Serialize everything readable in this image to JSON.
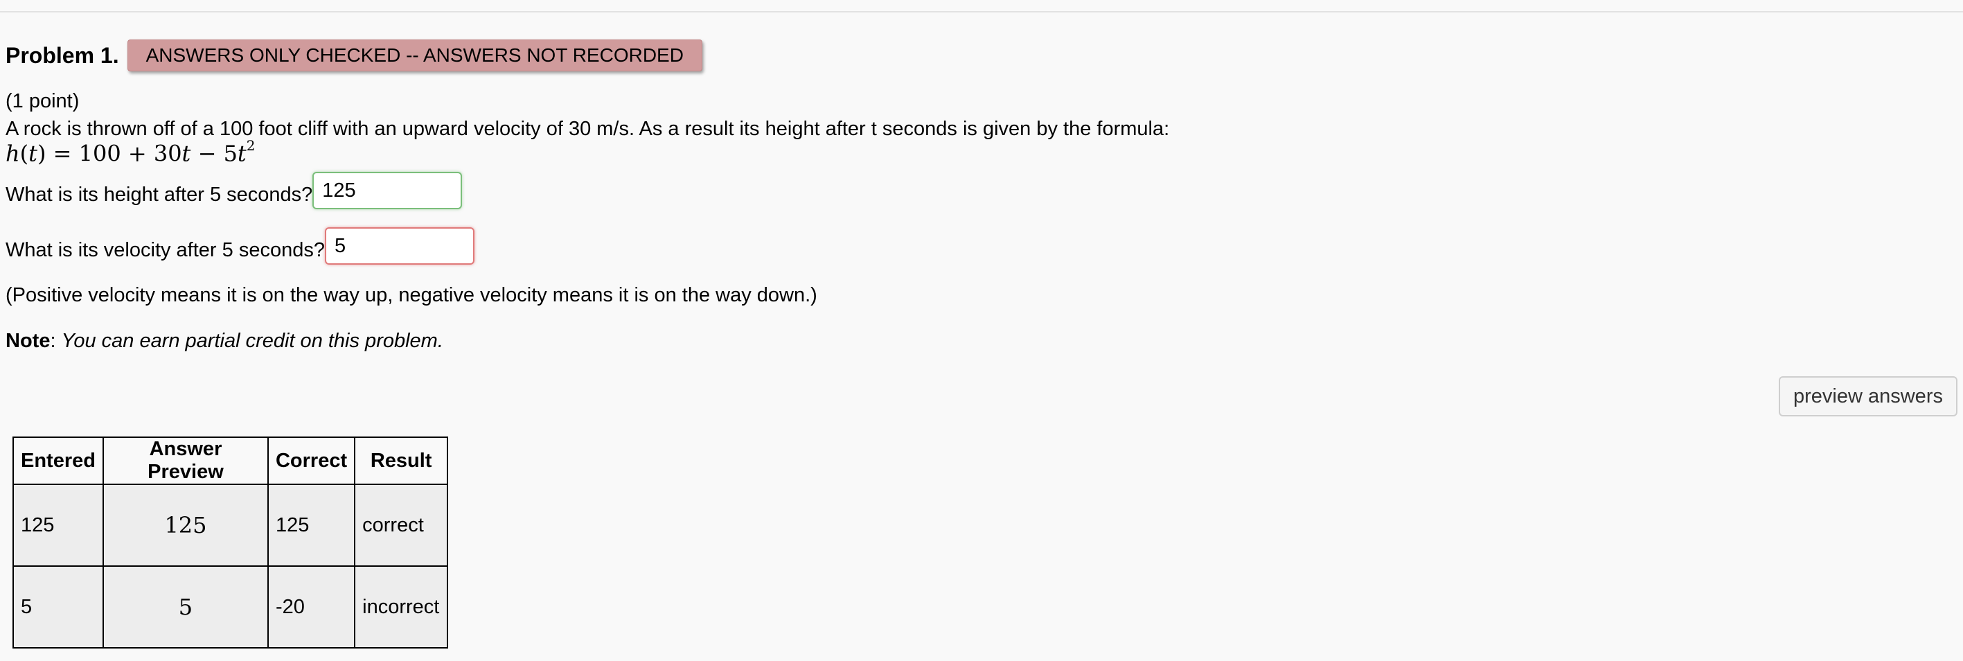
{
  "problem": {
    "title": "Problem 1.",
    "status_badge": "ANSWERS ONLY CHECKED -- ANSWERS NOT RECORDED",
    "points": "(1 point)",
    "statement": "A rock is thrown off of a 100 foot cliff with an upward velocity of 30 m/s. As a result its height after t seconds is given by the formula:",
    "formula": {
      "lhs_fn": "h",
      "lhs_var": "t",
      "rhs_a": "100 + 30",
      "rhs_t1": "t",
      "rhs_b": " − 5",
      "rhs_t2": "t",
      "exponent": "2"
    },
    "questions": [
      {
        "label": "What is its height after 5 seconds?",
        "value": "125",
        "state": "correct"
      },
      {
        "label": "What is its velocity after 5 seconds?",
        "value": "5",
        "state": "incorrect"
      }
    ],
    "clarification": "(Positive velocity means it is on the way up, negative velocity means it is on the way down.)",
    "note_label": "Note",
    "note_sep": ": ",
    "note_text": "You can earn partial credit on this problem."
  },
  "preview_button_label": "preview answers",
  "results_table": {
    "headers": [
      "Entered",
      "Answer Preview",
      "Correct",
      "Result"
    ],
    "rows": [
      [
        "125",
        "125",
        "125",
        "correct"
      ],
      [
        "5",
        "5",
        "-20",
        "incorrect"
      ]
    ]
  },
  "colors": {
    "badge_bg": "#d09b9c",
    "correct_border": "#7bbf7b",
    "incorrect_border": "#e07a7a",
    "page_bg": "#f9f9f9"
  }
}
